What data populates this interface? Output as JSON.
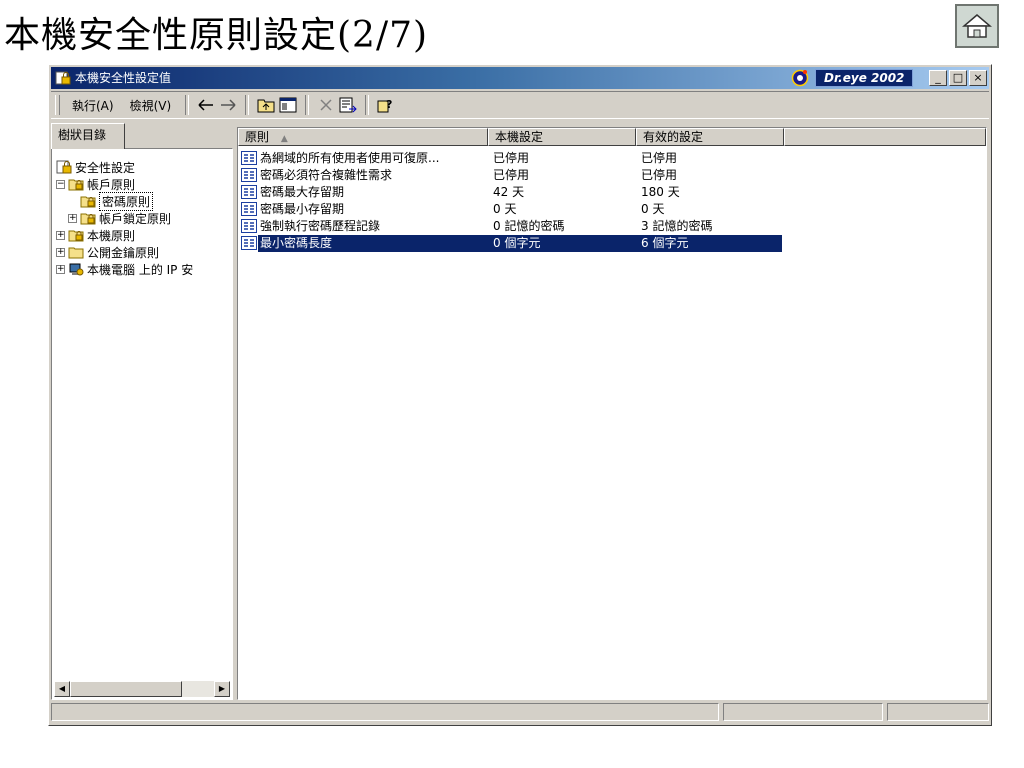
{
  "slide": {
    "title": "本機安全性原則設定(2/7)"
  },
  "window": {
    "title": "本機安全性設定值",
    "dreye_label": "Dr.eye 2002",
    "controls": [
      "_",
      "□",
      "×"
    ]
  },
  "toolbar": {
    "menu_action": "執行(A)",
    "menu_view": "檢視(V)"
  },
  "tree": {
    "tab_label": "樹狀目錄",
    "items": [
      {
        "label": "安全性設定"
      },
      {
        "label": "帳戶原則"
      },
      {
        "label": "密碼原則"
      },
      {
        "label": "帳戶鎖定原則"
      },
      {
        "label": "本機原則"
      },
      {
        "label": "公開金鑰原則"
      },
      {
        "label": "本機電腦 上的 IP 安"
      }
    ]
  },
  "list": {
    "columns": [
      "原則",
      "本機設定",
      "有效的設定"
    ],
    "rows": [
      {
        "policy": "為網域的所有使用者使用可復原...",
        "local": "已停用",
        "effective": "已停用"
      },
      {
        "policy": "密碼必須符合複雜性需求",
        "local": "已停用",
        "effective": "已停用"
      },
      {
        "policy": "密碼最大存留期",
        "local": "42 天",
        "effective": "180 天"
      },
      {
        "policy": "密碼最小存留期",
        "local": "0 天",
        "effective": "0 天"
      },
      {
        "policy": "強制執行密碼歷程記錄",
        "local": "0 記憶的密碼",
        "effective": "3 記憶的密碼"
      },
      {
        "policy": "最小密碼長度",
        "local": "0 個字元",
        "effective": "6 個字元"
      }
    ],
    "selected_row": 5
  },
  "colors": {
    "titlebar_start": "#0a246a",
    "titlebar_end": "#a6caf0",
    "selection": "#0a246a",
    "chrome": "#d4d0c8"
  }
}
